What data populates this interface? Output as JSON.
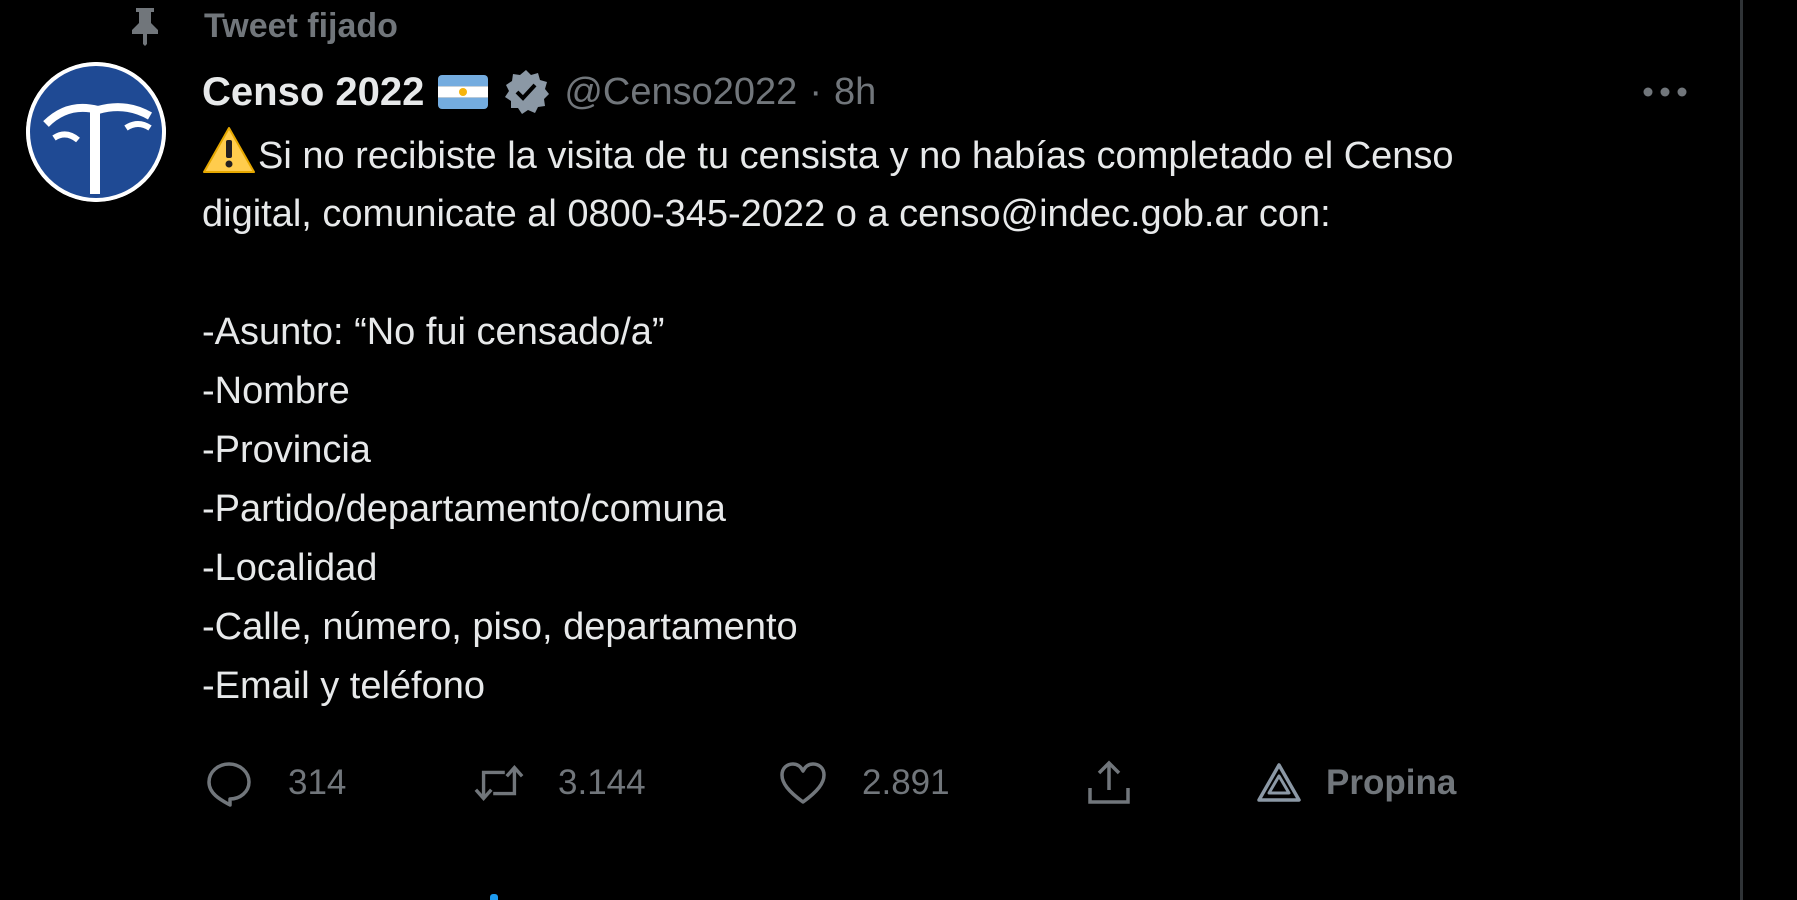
{
  "pinned": {
    "label": "Tweet fijado",
    "icon": "pin-icon"
  },
  "tweet": {
    "display_name": "Censo 2022",
    "handle": "@Censo2022",
    "separator": "·",
    "time": "8h",
    "verified": true,
    "flag": "argentina-flag",
    "body": {
      "line1": "Si no recibiste la visita de tu censista y no habías completado el Censo",
      "line2": "digital, comunicate al 0800-345-2022 o a censo@indec.gob.ar con:",
      "items": [
        "-Asunto: “No fui censado/a”",
        "-Nombre",
        "-Provincia",
        "-Partido/departamento/comuna",
        "-Localidad",
        "-Calle, número, piso, departamento",
        "-Email y teléfono"
      ]
    },
    "actions": {
      "reply_count": "314",
      "retweet_count": "3.144",
      "like_count": "2.891",
      "tip_label": "Propina"
    }
  },
  "colors": {
    "background": "#000000",
    "text": "#e7e9ea",
    "muted": "#71767b",
    "avatar_blue": "#1f4a94",
    "accent": "#1d9bf0"
  }
}
